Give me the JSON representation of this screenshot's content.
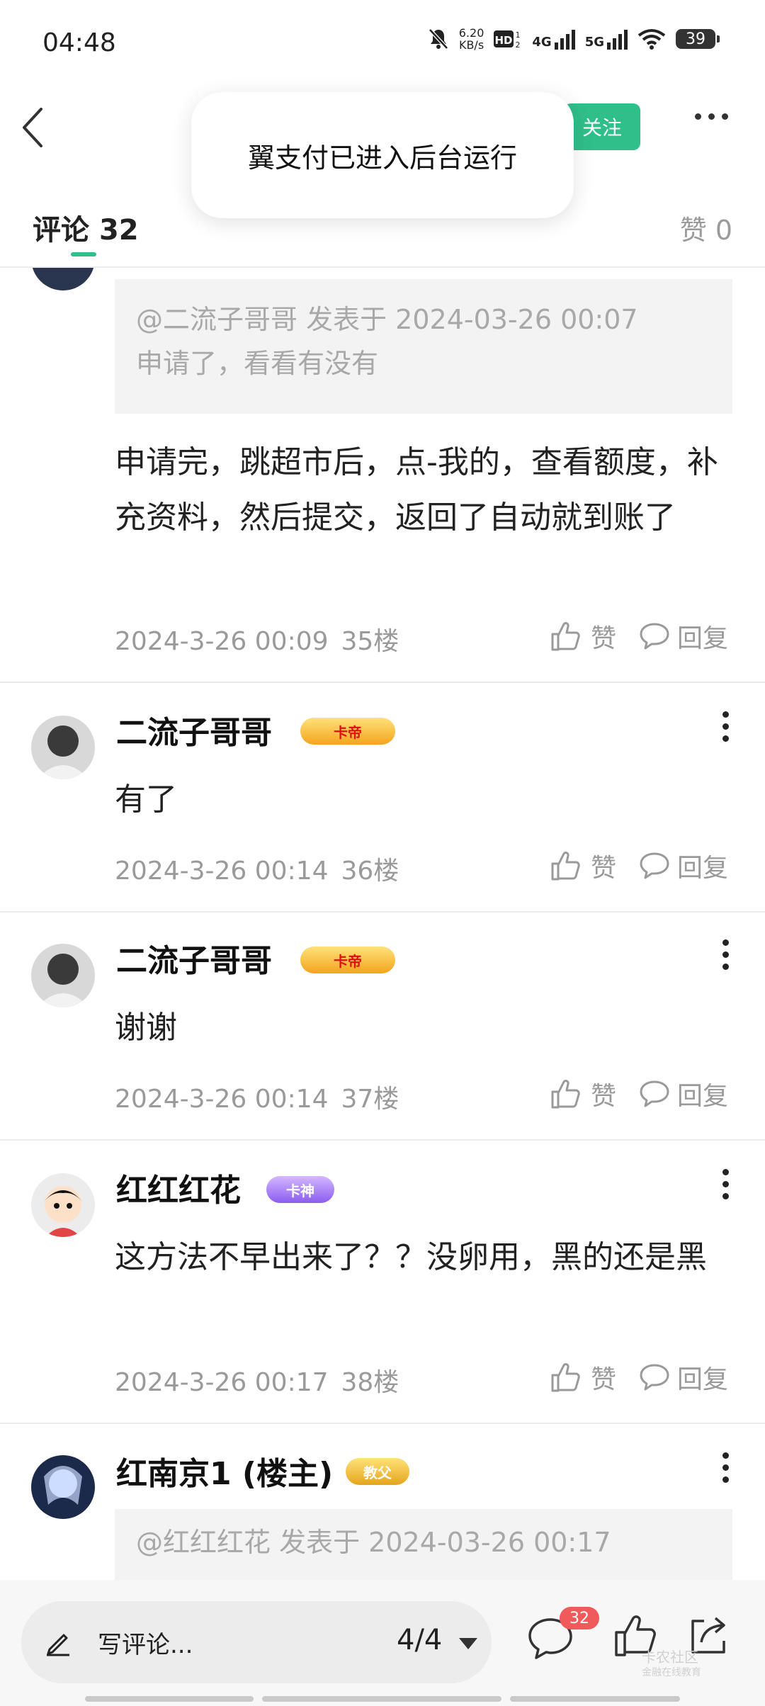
{
  "status": {
    "time": "04:48",
    "speed_value": "6.20",
    "speed_unit": "KB/s",
    "net1": "4G",
    "net2": "5G",
    "battery": "39"
  },
  "header": {
    "follow_label": "关注",
    "toast": "翼支付已进入后台运行"
  },
  "tabs": {
    "comments_label": "评论",
    "comments_count": "32",
    "likes_label": "赞",
    "likes_count": "0"
  },
  "actions": {
    "like_label": "赞",
    "reply_label": "回复"
  },
  "comments": [
    {
      "quote_line1": "@二流子哥哥 发表于 2024-03-26 00:07",
      "quote_line2": "申请了，看看有没有",
      "text": "申请完，跳超市后，点-我的，查看额度，补充资料，然后提交，返回了自动就到账了",
      "date": "2024-3-26 00:09",
      "floor": "35楼"
    },
    {
      "user": "二流子哥哥",
      "badge": "卡帝",
      "text": "有了",
      "date": "2024-3-26 00:14",
      "floor": "36楼"
    },
    {
      "user": "二流子哥哥",
      "badge": "卡帝",
      "text": "谢谢",
      "date": "2024-3-26 00:14",
      "floor": "37楼"
    },
    {
      "user": "红红红花",
      "badge": "卡神",
      "text": "这方法不早出来了？？没卵用，黑的还是黑",
      "date": "2024-3-26 00:17",
      "floor": "38楼"
    },
    {
      "user": "红南京1 (楼主)",
      "badge": "教父",
      "quote_line1": "@红红红花 发表于 2024-03-26 00:17"
    }
  ],
  "bottom": {
    "write_placeholder": "写评论...",
    "pager": "4/4",
    "comment_count": "32",
    "watermark_line1": "卡农社区",
    "watermark_line2": "金融在线教育"
  },
  "colors": {
    "accent": "#2fbf8a",
    "badge_red": "#f15a5a"
  }
}
